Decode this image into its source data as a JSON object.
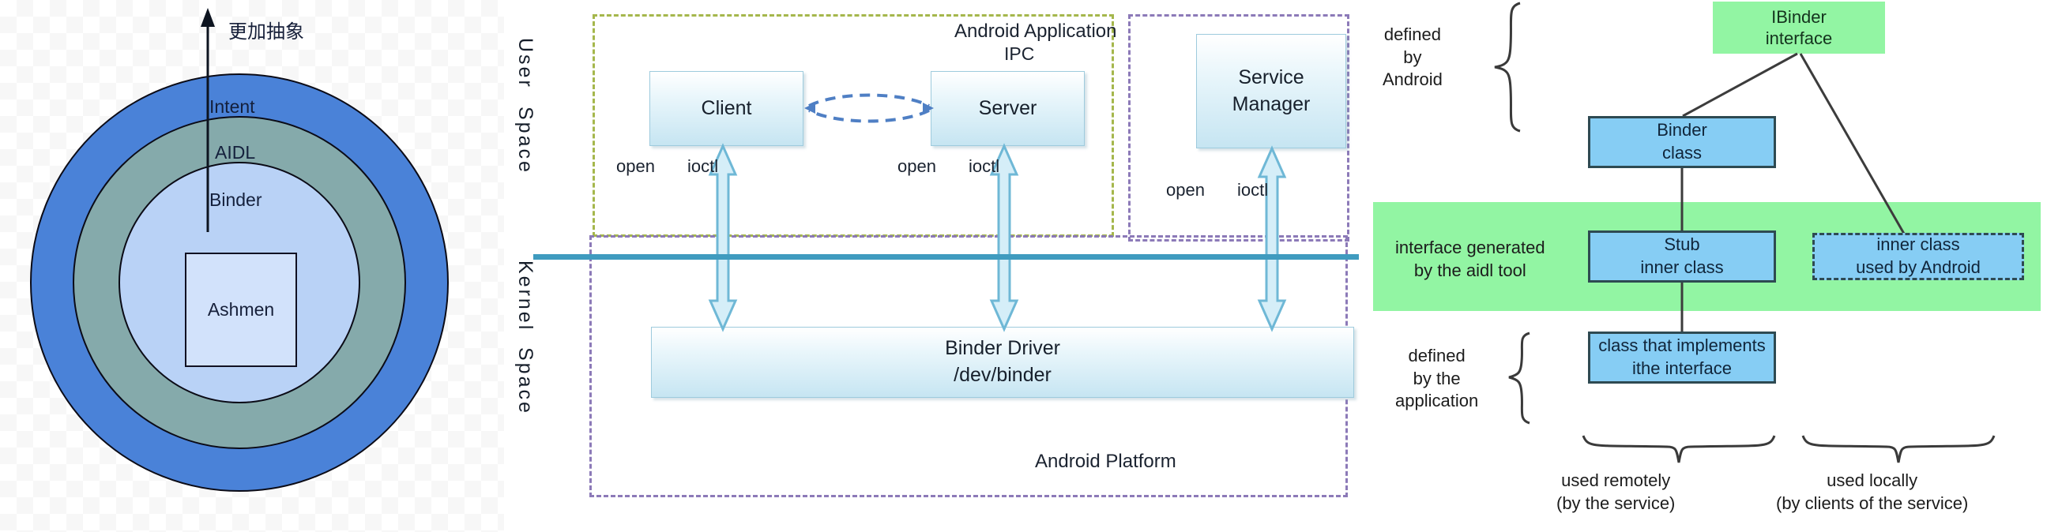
{
  "left_diagram": {
    "title_arrow_label": "更加抽象",
    "rings": [
      {
        "name": "Intent",
        "label": "Intent",
        "color": "#4a82d8"
      },
      {
        "name": "AIDL",
        "label": "AIDL",
        "color": "#85aaab"
      },
      {
        "name": "Binder",
        "label": "Binder",
        "color": "#b9d2f6"
      }
    ],
    "core_box_label": "Ashmen"
  },
  "middle_diagram": {
    "app_container_label": "Android Application",
    "platform_container_label": "Android Platform",
    "user_space_line1": "User",
    "user_space_line2": "Space",
    "kernel_space_line1": "Kernel",
    "kernel_space_line2": "Space",
    "ipc_label": "IPC",
    "client_label": "Client",
    "server_label": "Server",
    "service_manager_line1": "Service",
    "service_manager_line2": "Manager",
    "driver_line1": "Binder Driver",
    "driver_line2": "/dev/binder",
    "syscalls": {
      "open": "open",
      "ioctl": "ioctl"
    }
  },
  "right_diagram": {
    "ibinder_line1": "IBinder",
    "ibinder_line2": "interface",
    "binder_class_line1": "Binder",
    "binder_class_line2": "class",
    "stub_line1": "Stub",
    "stub_line2": "inner class",
    "inner_class_line1": "inner class",
    "inner_class_line2": "used by Android",
    "impl_line1": "class that implements",
    "impl_line2": "ithe interface",
    "defined_by_android_line1": "defined",
    "defined_by_android_line2": "by",
    "defined_by_android_line3": "Android",
    "aidl_generated_line1": "interface generated",
    "aidl_generated_line2": "by the aidl tool",
    "defined_by_app_line1": "defined",
    "defined_by_app_line2": "by the",
    "defined_by_app_line3": "application",
    "used_remotely_line1": "used remotely",
    "used_remotely_line2": "(by the service)",
    "used_locally_line1": "used locally",
    "used_locally_line2": "(by clients of the service)"
  },
  "colors": {
    "ring_outer": "#4a82d8",
    "ring_middle": "#85aaab",
    "ring_inner": "#b9d2f6",
    "green_band": "#92f5a3",
    "class_box": "#86cdf4",
    "kernel_rule": "#3f9bbf",
    "dash_green": "#a5b74c",
    "dash_purple": "#8c7ab8"
  }
}
